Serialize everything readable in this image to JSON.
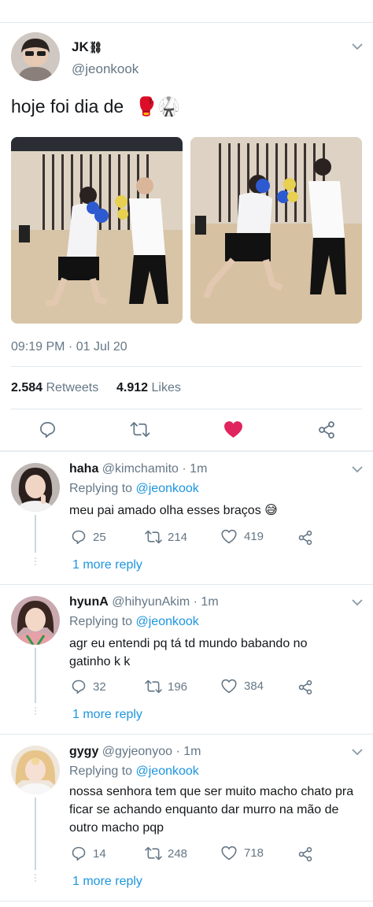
{
  "tweet": {
    "name": "JK",
    "name_emoji": "⛓",
    "handle": "@jeonkook",
    "text": "hoje foi dia de",
    "text_emojis": "🥊🥋",
    "timestamp": "09:19 PM · 01 Jul 20",
    "retweets_count": "2.584",
    "retweets_label": "Retweets",
    "likes_count": "4.912",
    "likes_label": "Likes"
  },
  "replies": [
    {
      "name": "haha",
      "handle": "@kimchamito",
      "time": "· 1m",
      "replying_prefix": "Replying to",
      "replying_to": "@jeonkook",
      "text": "meu pai amado olha esses braços 😅",
      "replies": "25",
      "retweets": "214",
      "likes": "419",
      "more": "1 more reply"
    },
    {
      "name": "hyunA",
      "handle": "@hihyunAkim",
      "time": "· 1m",
      "replying_prefix": "Replying to",
      "replying_to": "@jeonkook",
      "text": "agr eu entendi pq tá td mundo babando no gatinho k k",
      "replies": "32",
      "retweets": "196",
      "likes": "384",
      "more": "1 more reply"
    },
    {
      "name": "gygy",
      "handle": "@gyjeonyoo",
      "time": "· 1m",
      "replying_prefix": "Replying to",
      "replying_to": "@jeonkook",
      "text": "nossa senhora tem que ser muito macho chato pra ficar se achando enquanto dar murro na mão de outro macho pqp",
      "replies": "14",
      "retweets": "248",
      "likes": "718",
      "more": "1 more reply"
    }
  ],
  "colors": {
    "link": "#1b95e0",
    "muted": "#657786",
    "like": "#e0245e",
    "divider": "#e1e8ed"
  }
}
